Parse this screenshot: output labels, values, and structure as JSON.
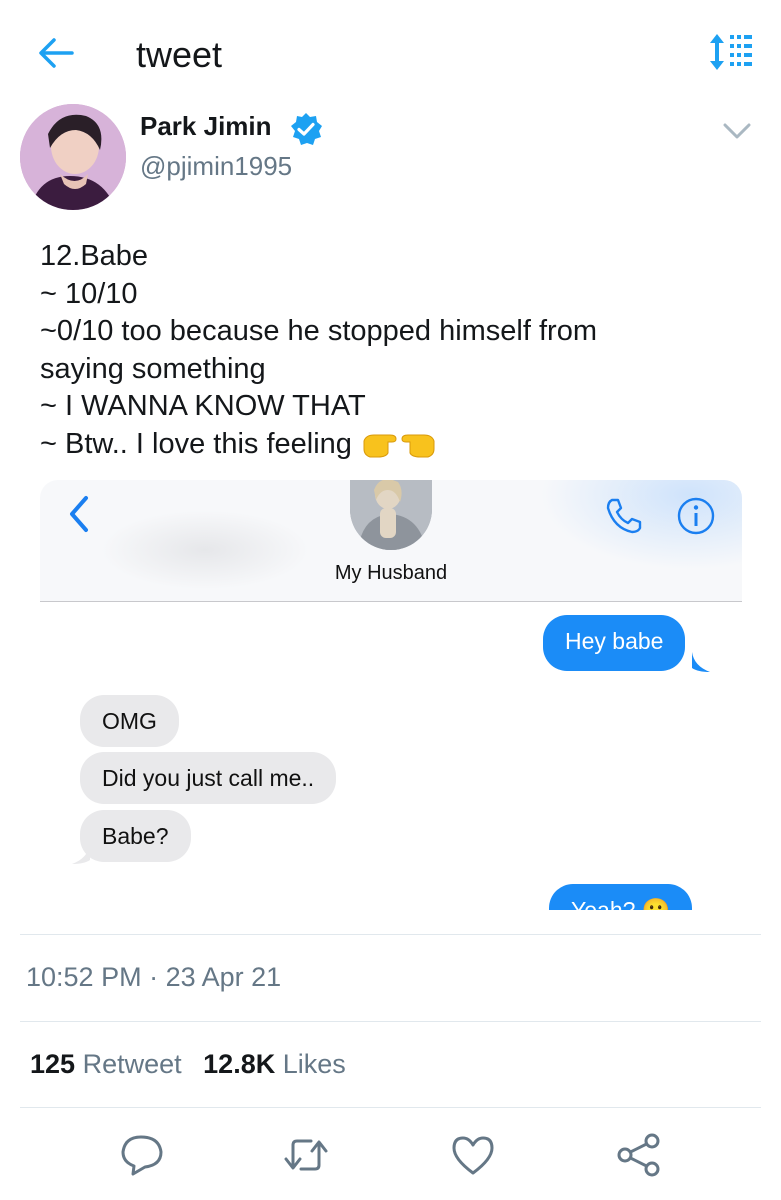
{
  "topbar": {
    "title": "tweet"
  },
  "author": {
    "name": "Park Jimin",
    "handle": "@pjimin1995"
  },
  "tweet": {
    "lines": [
      "12.Babe",
      "~ 10/10",
      "~0/10 too because he stopped himself from",
      "saying something",
      "~ I WANNA KNOW THAT",
      "~ Btw.. I love this feeling"
    ]
  },
  "media": {
    "contact_name": "My Husband",
    "messages": [
      {
        "dir": "out",
        "text": "Hey babe"
      },
      {
        "dir": "in",
        "text": "OMG"
      },
      {
        "dir": "in",
        "text": "Did you just call me.."
      },
      {
        "dir": "in",
        "text": "Babe?"
      },
      {
        "dir": "out",
        "text": "Yeah? 🙂"
      }
    ]
  },
  "meta": {
    "time": "10:52 PM",
    "separator": "·",
    "date": "23 Apr 21"
  },
  "stats": {
    "retweets": "125",
    "retweet_label": "Retweet",
    "likes": "12.8K",
    "likes_label": "Likes"
  },
  "colors": {
    "accent": "#1da1f2",
    "imessage_blue": "#1b8cf7",
    "grey_text": "#657786",
    "verified": "#1da1f2"
  },
  "icons": {
    "back": "arrow-left-icon",
    "sort": "sort-icon",
    "verified": "verified-badge-icon",
    "more": "chevron-down-icon",
    "reply": "reply-icon",
    "retweet": "retweet-icon",
    "like": "heart-icon",
    "share": "share-icon"
  }
}
